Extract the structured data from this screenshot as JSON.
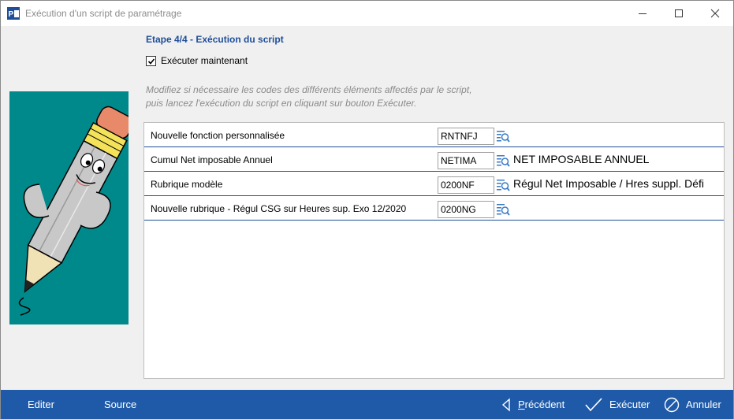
{
  "window": {
    "title": "Exécution d'un script de paramétrage",
    "icons": {
      "app": "app-icon",
      "minimize": "minimize-icon",
      "maximize": "maximize-icon",
      "close": "close-icon"
    }
  },
  "step": {
    "title": "Etape 4/4 - Exécution du script",
    "execute_now": {
      "label": "Exécuter maintenant",
      "checked": true
    },
    "help_line1": "Modifiez si nécessaire les codes des différents éléments affectés par le script,",
    "help_line2": "puis lancez l'exécution du script en cliquant sur bouton Exécuter."
  },
  "rows": [
    {
      "label": "Nouvelle fonction personnalisée",
      "code": "RNTNFJ",
      "description": ""
    },
    {
      "label": "Cumul Net imposable Annuel",
      "code": "NETIMA",
      "description": "NET IMPOSABLE ANNUEL"
    },
    {
      "label": "Rubrique modèle",
      "code": "0200NF",
      "description": "Régul Net Imposable / Hres suppl. Défi"
    },
    {
      "label": "Nouvelle rubrique - Régul CSG sur Heures sup. Exo 12/2020",
      "code": "0200NG",
      "description": ""
    }
  ],
  "footer": {
    "edit_label": "Editer",
    "source_label": "Source",
    "previous_label": "Précédent",
    "execute_label": "Exécuter",
    "cancel_label": "Annuler"
  },
  "colors": {
    "accent": "#1f5aa8",
    "title_blue": "#1f4e9a",
    "illustration_bg": "#00898b"
  }
}
